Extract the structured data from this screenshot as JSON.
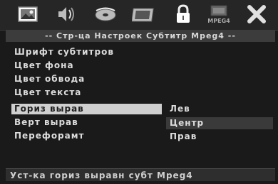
{
  "toolbar": {
    "icons": [
      "picture-icon",
      "audio-icon",
      "disc-icon",
      "video-icon",
      "lock-icon",
      "mpeg4-icon",
      "close-icon"
    ],
    "mpeg4_label": "MPEG4"
  },
  "title": "-- Стр-ца Настроек Субтитр Mpeg4 --",
  "menu": {
    "items": [
      {
        "label": "Шрифт субтитров"
      },
      {
        "label": "Цвет фона"
      },
      {
        "label": "Цвет обвода"
      },
      {
        "label": "Цвет текста"
      },
      {
        "label": "Гориз вырав",
        "selected": true
      },
      {
        "label": "Верт вырав"
      },
      {
        "label": "Перефорамт"
      }
    ]
  },
  "options": {
    "items": [
      {
        "label": "Лев"
      },
      {
        "label": "Центр",
        "active": true
      },
      {
        "label": "Прав"
      }
    ]
  },
  "status": "Уст-ка гориз выравн субт Mpeg4",
  "colors": {
    "background": "#1a1a1a",
    "highlight": "#cfcfcf",
    "text": "#e6e6e6"
  }
}
